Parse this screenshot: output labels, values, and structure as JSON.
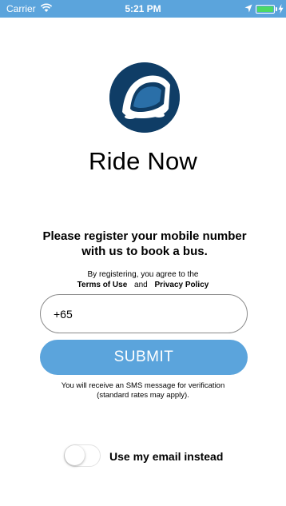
{
  "status_bar": {
    "carrier": "Carrier",
    "time": "5:21 PM",
    "background": "#5ba4dc",
    "battery_color": "#4cd964"
  },
  "app": {
    "title": "Ride Now",
    "logo_icon": "bus-icon",
    "logo_color": "#0f3d66"
  },
  "register": {
    "headline": "Please register your mobile number with us to book a bus.",
    "agree_text": "By registering, you agree to the",
    "terms_link": "Terms of Use",
    "and_text": "and",
    "privacy_link": "Privacy Policy"
  },
  "phone_input": {
    "value": "+65"
  },
  "submit": {
    "label": "SUBMIT",
    "color": "#5ba4dc"
  },
  "sms_note": {
    "line1": "You will receive an SMS message for verification",
    "line2": "(standard rates may apply)."
  },
  "email_toggle": {
    "label": "Use my email instead",
    "on": false
  }
}
